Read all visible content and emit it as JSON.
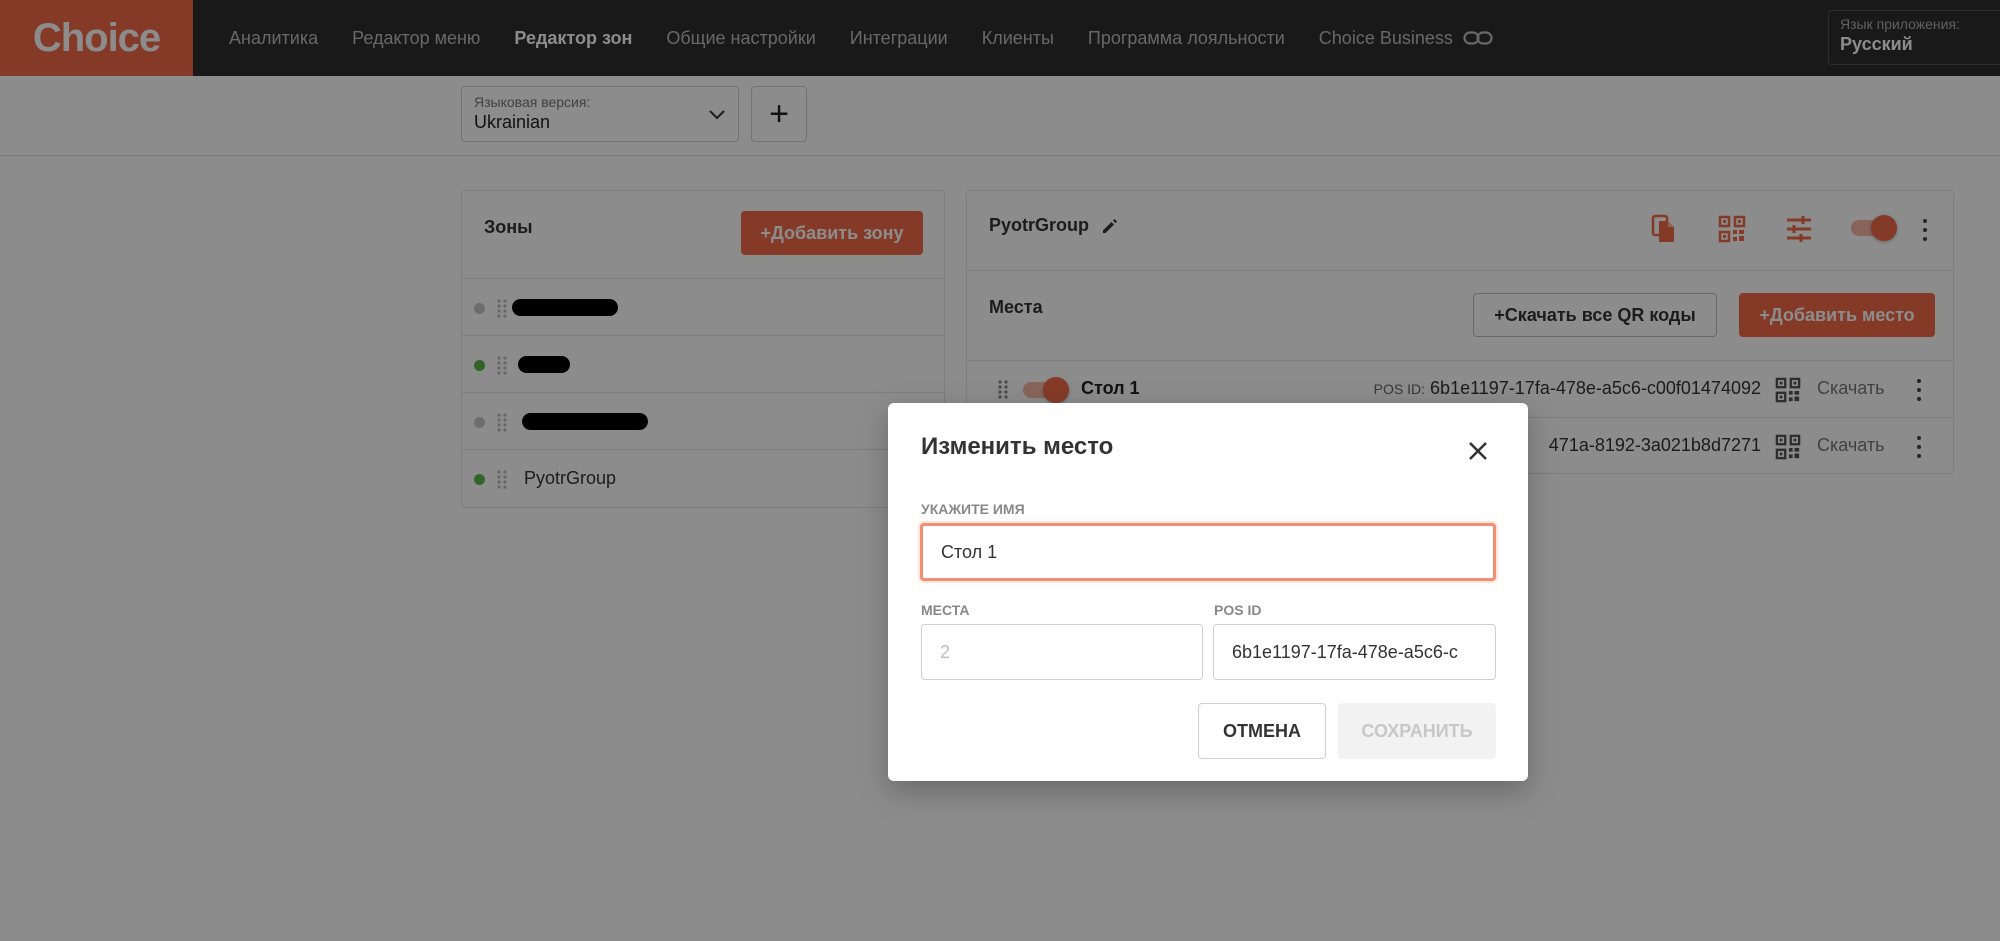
{
  "app": {
    "logo": "Choice"
  },
  "nav": {
    "items": [
      {
        "label": "Аналитика",
        "active": false
      },
      {
        "label": "Редактор меню",
        "active": false
      },
      {
        "label": "Редактор зон",
        "active": true
      },
      {
        "label": "Общие настройки",
        "active": false
      },
      {
        "label": "Интеграции",
        "active": false
      },
      {
        "label": "Клиенты",
        "active": false
      },
      {
        "label": "Программа лояльности",
        "active": false
      },
      {
        "label": "Choice Business",
        "active": false,
        "icon": "link-icon"
      }
    ],
    "app_language": {
      "label": "Язык приложения:",
      "value": "Русский"
    }
  },
  "subheader": {
    "language_version": {
      "label": "Языковая версия:",
      "value": "Ukrainian"
    },
    "add_button": "+"
  },
  "zones": {
    "title": "Зоны",
    "add_button": "+Добавить зону",
    "items": [
      {
        "name": "",
        "status": "inactive",
        "redacted": true
      },
      {
        "name": "",
        "status": "active",
        "redacted": true
      },
      {
        "name": "",
        "status": "inactive",
        "redacted": true
      },
      {
        "name": "PyotrGroup",
        "status": "active",
        "redacted": false
      }
    ]
  },
  "group": {
    "title": "PyotrGroup",
    "enabled": true,
    "icons": [
      "copy-icon",
      "qr-code-icon",
      "settings-sliders-icon"
    ]
  },
  "places": {
    "title": "Места",
    "download_qr_button": "+Скачать все QR коды",
    "add_button": "+Добавить место",
    "pos_label": "POS ID:",
    "download_label": "Скачать",
    "items": [
      {
        "name": "Стол 1",
        "pos_id": "6b1e1197-17fa-478e-a5c6-c00f01474092",
        "enabled": true
      },
      {
        "name": "",
        "pos_id": "471a-8192-3a021b8d7271",
        "enabled": true
      }
    ]
  },
  "dialog": {
    "title": "Изменить место",
    "name_label": "УКАЖИТЕ ИМЯ",
    "name_value": "Стол 1",
    "seats_label": "МЕСТА",
    "seats_placeholder": "2",
    "pos_label": "POS ID",
    "pos_value": "6b1e1197-17fa-478e-a5c6-c",
    "cancel_button": "ОТМЕНА",
    "save_button": "СОХРАНИТЬ"
  },
  "colors": {
    "accent": "#f26b4a",
    "topbar": "#2f2f2f",
    "active_dot": "#58b947",
    "inactive_dot": "#c7c7c7"
  }
}
